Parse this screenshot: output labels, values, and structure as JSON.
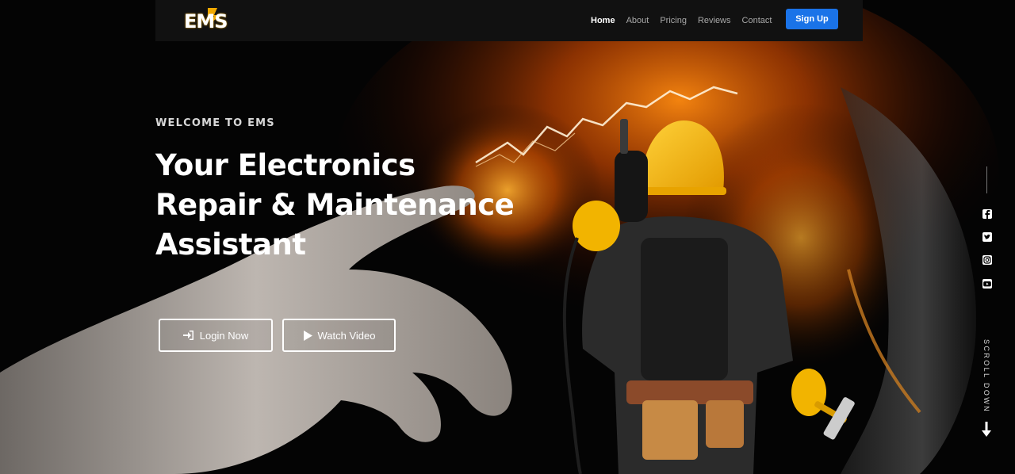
{
  "brand": {
    "logo_text": "EMS"
  },
  "nav": {
    "links": [
      {
        "label": "Home",
        "active": true
      },
      {
        "label": "About",
        "active": false
      },
      {
        "label": "Pricing",
        "active": false
      },
      {
        "label": "Reviews",
        "active": false
      },
      {
        "label": "Contact",
        "active": false
      }
    ],
    "signup_label": "Sign Up"
  },
  "hero": {
    "kicker": "WELCOME TO EMS",
    "headline_lines": [
      "Your Electronics",
      "Repair & Maintenance",
      "Assistant"
    ],
    "login_label": "Login Now",
    "video_label": "Watch Video"
  },
  "social": {
    "icons": [
      "facebook-icon",
      "twitter-icon",
      "instagram-icon",
      "youtube-icon"
    ],
    "scroll_label": "SCROLL DOWN"
  },
  "colors": {
    "accent": "#1a73e8",
    "nav_bg": "#111111",
    "fire": "#ff7a00",
    "helmet": "#f5b400"
  }
}
